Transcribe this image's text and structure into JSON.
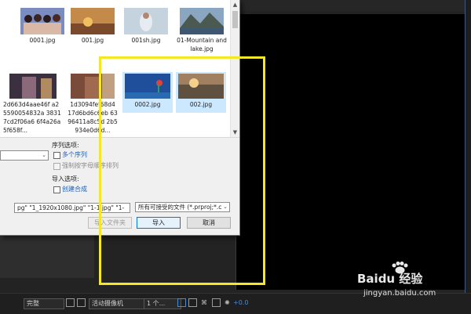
{
  "dialog": {
    "files": [
      {
        "name": "0001.jpg",
        "selected": false
      },
      {
        "name": "001.jpg",
        "selected": false
      },
      {
        "name": "001sh.jpg",
        "selected": false
      },
      {
        "name": "01-Mountain and lake.jpg",
        "selected": false
      },
      {
        "name": "2d663d4aae46f a25590054832a 38317cd2f06a6 6f4a26a5f658f...",
        "selected": false
      },
      {
        "name": "1d3094fef68d4 17d6bd6c6eb 6396411a8c5d 2b5934e0d6d...",
        "selected": false
      },
      {
        "name": "0002.jpg",
        "selected": true
      },
      {
        "name": "002.jpg",
        "selected": true
      }
    ],
    "sequence_options_label": "序列选项:",
    "multi_sequence_label": "多个序列",
    "force_alpha_label": "强制按字母顺序排列",
    "import_options_label": "导入选项:",
    "create_composition_label": "创建合成",
    "filename_value": "pg\" \"1_1920x1080.jpg\" \"1-1.jpg\" \"1-",
    "filetype_value": "所有可接受的文件 (*.prproj;*.c",
    "import_folder_button": "导入文件夹",
    "import_button": "导入",
    "cancel_button": "取消"
  },
  "bottombar": {
    "quality": "完整",
    "camera": "活动摄像机",
    "views": "1 个...",
    "exposure": "+0.0"
  },
  "watermark": {
    "brand": "Baidu 经验",
    "url": "jingyan.baidu.com"
  },
  "colors": {
    "highlight": "#f5e626",
    "selection": "#cce8ff",
    "link_blue": "#1f5fb0"
  }
}
